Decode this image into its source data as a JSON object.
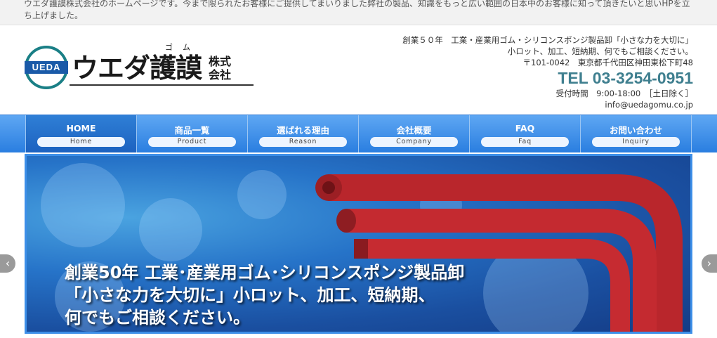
{
  "intro": {
    "text": "ウエダ護謨株式会社のホームページです。今まで限られたお客様にご提供してまいりました弊社の製品、知識をもっと広い範囲の日本中のお客様に知って頂きたいと思いHPを立ち上げました。"
  },
  "logo": {
    "badge": "UEDA",
    "name": "ウエダ護謨",
    "furigana": "ゴム",
    "kabushiki": "株式会社"
  },
  "contact": {
    "tagline1": "創業５０年　工業・産業用ゴム・シリコンスポンジ製品卸「小さな力を大切に」",
    "tagline2": "小ロット、加工、短納期、何でもご相談ください。",
    "address": "〒101-0042　東京都千代田区神田東松下町48",
    "tel": "TEL 03-3254-0951",
    "hours": "受付時間　9:00-18:00　［土日除く］",
    "email": "info@uedagomu.co.jp"
  },
  "nav": {
    "items": [
      {
        "label": "HOME",
        "sub": "Home"
      },
      {
        "label": "商品一覧",
        "sub": "Product"
      },
      {
        "label": "選ばれる理由",
        "sub": "Reason"
      },
      {
        "label": "会社概要",
        "sub": "Company"
      },
      {
        "label": "FAQ",
        "sub": "Faq"
      },
      {
        "label": "お問い合わせ",
        "sub": "Inquiry"
      }
    ]
  },
  "hero": {
    "line1": "創業50年 工業･産業用ゴム･シリコンスポンジ製品卸",
    "line2": "「小さな力を大切に」小ロット、加工、短納期、",
    "line3": "何でもご相談ください。"
  },
  "slider": {
    "prev_icon": "chevron-left-icon",
    "next_icon": "chevron-right-icon"
  },
  "colors": {
    "accent": "#3f7f8f",
    "nav_blue": "#2a7ee0",
    "tube_red": "#c0272d"
  }
}
